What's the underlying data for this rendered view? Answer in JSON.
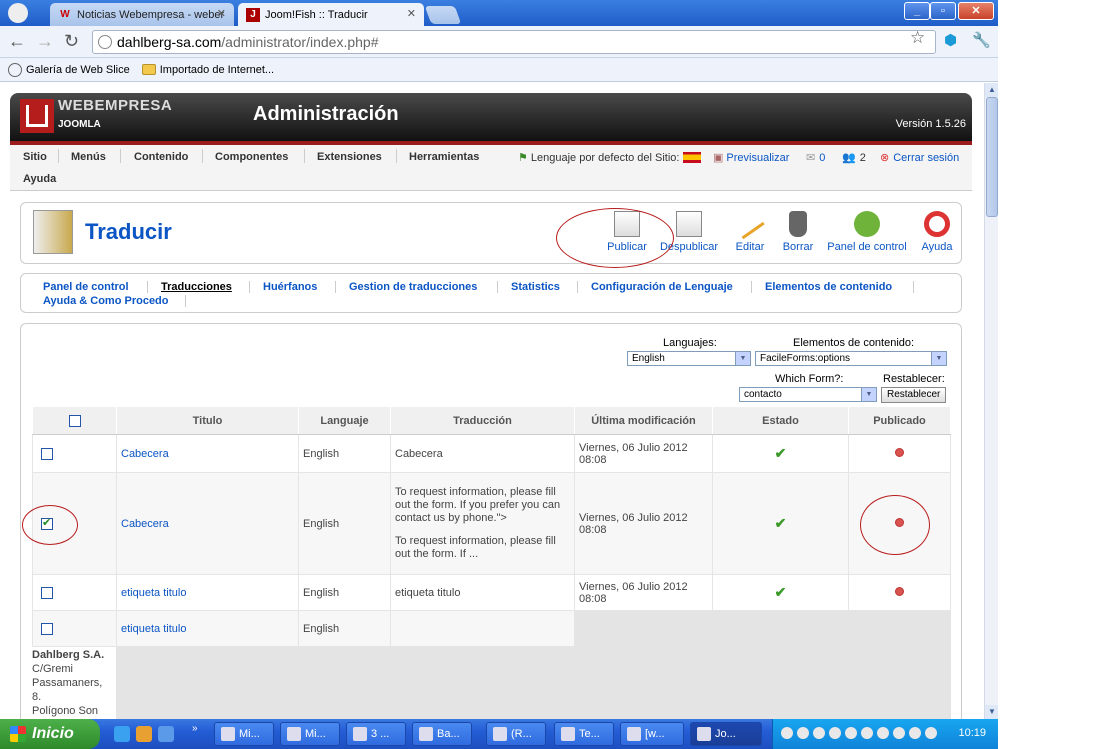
{
  "browser": {
    "tabs": [
      {
        "label": "Noticias Webempresa - weber",
        "favicon": "W",
        "active": false
      },
      {
        "label": "Joom!Fish :: Traducir",
        "favicon": "J",
        "active": true
      }
    ],
    "url_host": "dahlberg-sa.com",
    "url_path": "/administrator/index.php#",
    "bookmarks": [
      "Galería de Web Slice",
      "Importado de Internet..."
    ]
  },
  "header": {
    "brand_top": "WEBEMPRESA",
    "brand_bottom": "JOOMLA",
    "title": "Administración",
    "version": "Versión 1.5.26"
  },
  "menu": {
    "items": [
      "Sitio",
      "Menús",
      "Contenido",
      "Componentes",
      "Extensiones",
      "Herramientas",
      "Ayuda"
    ],
    "lang_label": "Lenguaje por defecto del Sitio:",
    "preview": "Previsualizar",
    "count_msgs": "0",
    "count_users": "2",
    "logout": "Cerrar sesión"
  },
  "toolbar": {
    "title": "Traducir",
    "buttons": [
      "Publicar",
      "Despublicar",
      "Editar",
      "Borrar",
      "Panel de control",
      "Ayuda"
    ]
  },
  "submenu": {
    "items": [
      "Panel de control",
      "Traducciones",
      "Huérfanos",
      "Gestion de traducciones",
      "Statistics",
      "Configuración de Lenguaje",
      "Elementos de contenido",
      "Ayuda & Como Procedo"
    ],
    "active": "Traducciones"
  },
  "filters": {
    "languages_label": "Languajes:",
    "languages_value": "English",
    "elements_label": "Elementos de contenido:",
    "elements_value": "FacileForms:options",
    "form_label": "Which Form?:",
    "form_value": "contacto",
    "reset_label": "Restablecer:",
    "reset_button": "Restablecer"
  },
  "table": {
    "headers": [
      "Titulo",
      "Languaje",
      "Traducción",
      "Última modificación",
      "Estado",
      "Publicado"
    ],
    "rows": [
      {
        "title": "Cabecera",
        "lang": "English",
        "translation": "Cabecera",
        "modified": "Viernes, 06 Julio 2012 08:08",
        "checked": false
      },
      {
        "title": "Cabecera",
        "lang": "English",
        "translation": "To request information, please fill out the form. If you prefer you can contact us by phone.\">",
        "translation2": "To request information, please fill out the form. If ...",
        "modified": "Viernes, 06 Julio 2012 08:08",
        "checked": true
      },
      {
        "title": "etiqueta titulo",
        "lang": "English",
        "translation": "etiqueta titulo",
        "modified": "Viernes, 06 Julio 2012 08:08",
        "checked": false
      },
      {
        "title": "etiqueta titulo",
        "lang": "English",
        "translation": "",
        "modified": "",
        "checked": false
      }
    ]
  },
  "footer": {
    "company": "Dahlberg S.A.",
    "line1": "C/Gremi",
    "line2": "Passamaners,",
    "line3": "8.",
    "line4": "Polígono Son"
  },
  "taskbar": {
    "start": "Inicio",
    "tasks": [
      "Mi...",
      "Mi...",
      "3 ...",
      "Ba...",
      "(R...",
      "Te...",
      "[w...",
      "Jo..."
    ],
    "clock": "10:19"
  }
}
